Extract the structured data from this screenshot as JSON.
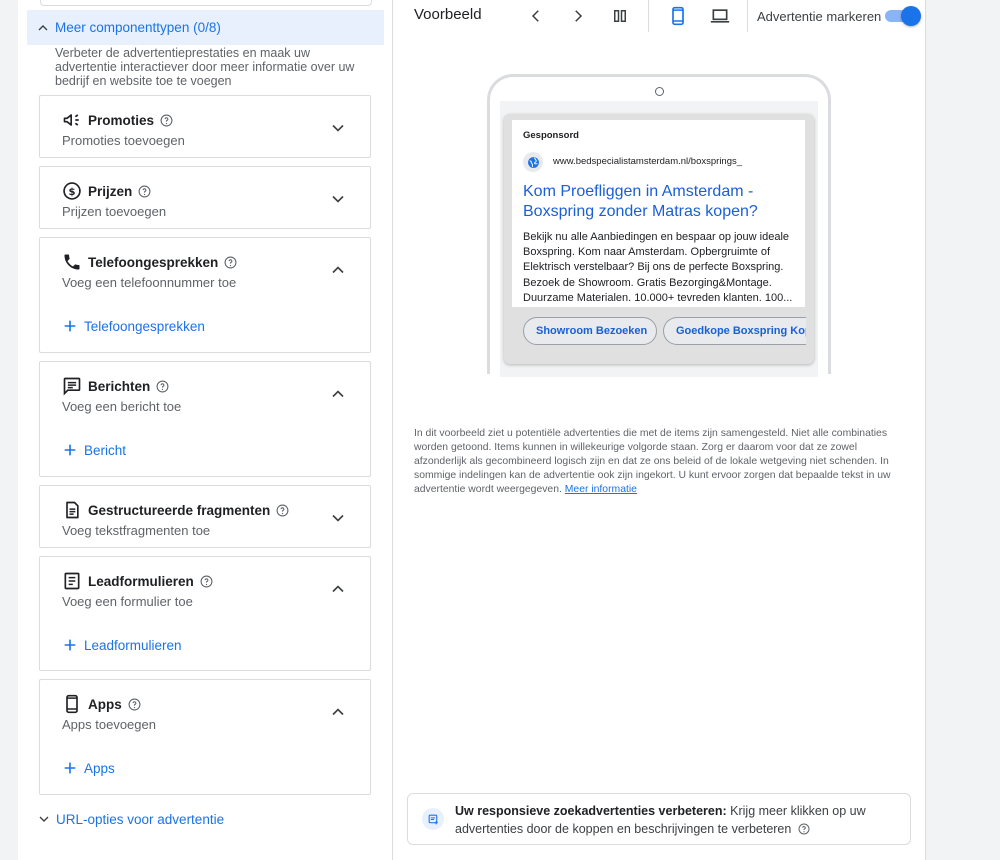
{
  "left": {
    "more_types": "Meer componenttypen (0/8)",
    "more_desc": "Verbeter de advertentieprestaties en maak uw advertentie interactiever door meer informatie over uw bedrijf en website toe te voegen",
    "cards": [
      {
        "title": "Promoties",
        "sub": "Promoties toevoegen",
        "icon": "megaphone-icon"
      },
      {
        "title": "Prijzen",
        "sub": "Prijzen toevoegen",
        "icon": "dollar-icon"
      },
      {
        "title": "Telefoongesprekken",
        "sub": "Voeg een telefoonnummer toe",
        "icon": "phone-icon",
        "add": "Telefoongesprekken"
      },
      {
        "title": "Berichten",
        "sub": "Voeg een bericht toe",
        "icon": "message-icon",
        "add": "Bericht"
      },
      {
        "title": "Gestructureerde fragmenten",
        "sub": "Voeg tekstfragmenten toe",
        "icon": "document-icon"
      },
      {
        "title": "Leadformulieren",
        "sub": "Voeg een formulier toe",
        "icon": "form-icon",
        "add": "Leadformulieren"
      },
      {
        "title": "Apps",
        "sub": "Apps toevoegen",
        "icon": "mobile-icon",
        "add": "Apps"
      }
    ],
    "url_options": "URL-opties voor advertentie"
  },
  "preview": {
    "title": "Voorbeeld",
    "mark_label": "Advertentie markeren",
    "mark_on": true,
    "ad": {
      "sponsored": "Gesponsord",
      "url": "www.bedspecialistamsterdam.nl/boxsprings_",
      "headline": "Kom Proefliggen in Amsterdam - Boxspring zonder Matras kopen?",
      "description": "Bekijk nu alle Aanbiedingen en bespaar op jouw ideale Boxspring. Kom naar Amsterdam. Opbergruimte of Elektrisch verstelbaar? Bij ons de perfecte Boxspring. Bezoek de Showroom. Gratis Bezorging&Montage. Duurzame Materialen. 10.000+ tevreden klanten. 100...",
      "sitelinks": [
        "Showroom Bezoeken",
        "Goedkope Boxspring Kopen"
      ]
    },
    "note": "In dit voorbeeld ziet u potentiële advertenties die met de items zijn samengesteld. Niet alle combinaties worden getoond. Items kunnen in willekeurige volgorde staan. Zorg er daarom voor dat ze zowel afzonderlijk als gecombineerd logisch zijn en dat ze ons beleid of de lokale wetgeving niet schenden. In sommige indelingen kan de advertentie ook zijn ingekort. U kunt ervoor zorgen dat bepaalde tekst in uw advertentie wordt weergegeven.",
    "note_link": "Meer informatie",
    "improve_bold": "Uw responsieve zoekadvertenties verbeteren:",
    "improve_text": "Krijg meer klikken op uw advertenties door de koppen en beschrijvingen te verbeteren"
  },
  "colors": {
    "accent": "#1a73e8",
    "headline": "#1a5fd6"
  }
}
